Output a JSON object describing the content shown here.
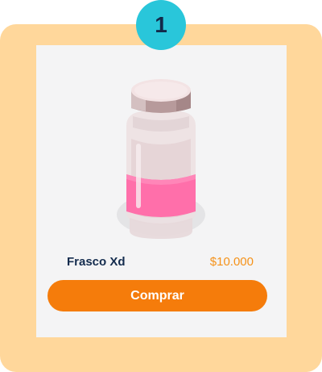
{
  "step": {
    "number": "1",
    "badge_color": "#29c6da"
  },
  "card": {
    "frame_color": "#ffd79b",
    "background_color": "#f4f4f5"
  },
  "product": {
    "image_icon": "medicine-bottle-icon",
    "name": "Frasco Xd",
    "price": "$10.000",
    "price_color": "#f59219"
  },
  "actions": {
    "buy_label": "Comprar",
    "buy_color": "#f57c0b"
  }
}
